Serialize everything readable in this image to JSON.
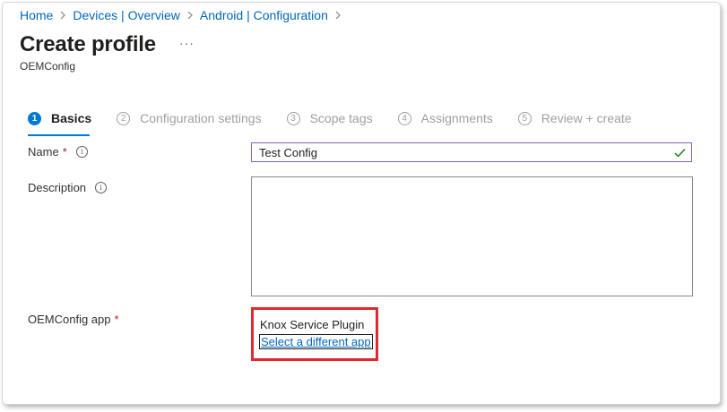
{
  "breadcrumb": [
    {
      "label": "Home"
    },
    {
      "label": "Devices | Overview"
    },
    {
      "label": "Android | Configuration"
    }
  ],
  "page": {
    "title": "Create profile",
    "more_label": "···",
    "subtitle": "OEMConfig"
  },
  "steps": [
    {
      "number": "1",
      "label": "Basics",
      "active": true
    },
    {
      "number": "2",
      "label": "Configuration settings",
      "active": false
    },
    {
      "number": "3",
      "label": "Scope tags",
      "active": false
    },
    {
      "number": "4",
      "label": "Assignments",
      "active": false
    },
    {
      "number": "5",
      "label": "Review + create",
      "active": false
    }
  ],
  "form": {
    "name": {
      "label": "Name",
      "required_mark": "*",
      "info": "i",
      "value": "Test Config",
      "valid": true
    },
    "description": {
      "label": "Description",
      "info": "i",
      "value": ""
    },
    "oemconfig_app": {
      "label": "OEMConfig app",
      "required_mark": "*",
      "app_name": "Knox Service Plugin",
      "change_link": "Select a different app"
    }
  },
  "colors": {
    "link": "#0067b8",
    "accent": "#0078d4",
    "required": "#a4262c",
    "valid_check": "#107c10",
    "highlight_box": "#e0282e",
    "input_focus_border": "#8764b8"
  },
  "icons": {
    "breadcrumb_separator": "chevron-right-icon",
    "info": "info-icon",
    "valid": "checkmark-icon",
    "more": "more-icon"
  }
}
